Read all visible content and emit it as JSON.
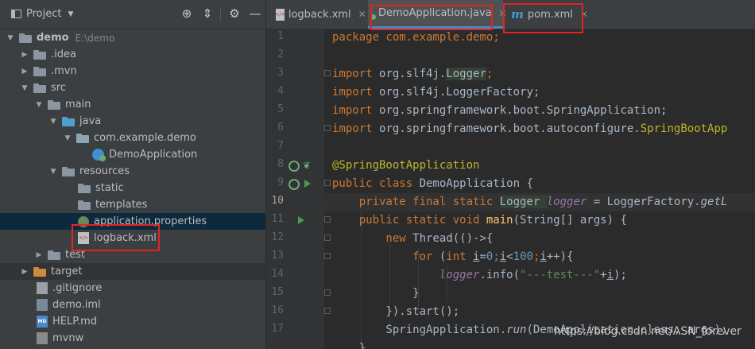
{
  "project_panel": {
    "title": "Project",
    "tree": [
      {
        "label": "demo",
        "path": "E:\\demo",
        "arrow": "▼",
        "folder": "gray"
      },
      {
        "label": ".idea",
        "arrow": "▶",
        "folder": "gray"
      },
      {
        "label": ".mvn",
        "arrow": "▶",
        "folder": "gray"
      },
      {
        "label": "src",
        "arrow": "▼",
        "folder": "gray"
      },
      {
        "label": "main",
        "arrow": "▼",
        "folder": "gray"
      },
      {
        "label": "java",
        "arrow": "▼",
        "folder": "blue"
      },
      {
        "label": "com.example.demo",
        "arrow": "▼",
        "folder": "gray"
      },
      {
        "label": "DemoApplication",
        "file": "spring-class-icon"
      },
      {
        "label": "resources",
        "arrow": "▼",
        "folder": "gray"
      },
      {
        "label": "static",
        "folder": "gray"
      },
      {
        "label": "templates",
        "folder": "gray"
      },
      {
        "label": "application.properties",
        "file": "properties-icon"
      },
      {
        "label": "logback.xml",
        "file": "xml-file-icon"
      },
      {
        "label": "test",
        "arrow": "▶",
        "folder": "gray"
      },
      {
        "label": "target",
        "arrow": "▶",
        "folder": "orange"
      },
      {
        "label": ".gitignore",
        "file": "text-file-icon"
      },
      {
        "label": "demo.iml",
        "file": "iml-file-icon"
      },
      {
        "label": "HELP.md",
        "file": "markdown-file-icon"
      },
      {
        "label": "mvnw",
        "file": "shell-file-icon"
      }
    ]
  },
  "tabs": [
    {
      "label": "logback.xml",
      "icon": "xml-file-icon"
    },
    {
      "label": "DemoApplication.java",
      "icon": "spring-class-icon"
    },
    {
      "label": "pom.xml",
      "icon": "maven-m-icon"
    }
  ],
  "editor": {
    "current_line": 10,
    "line_numbers": [
      "1",
      "2",
      "3",
      "4",
      "5",
      "6",
      "7",
      "8",
      "9",
      "10",
      "11",
      "12",
      "13",
      "14",
      "15",
      "16",
      "17"
    ],
    "lines": [
      [
        "package com.example.demo;"
      ],
      [
        ""
      ],
      [
        "import ",
        "org.slf4j.",
        "Logger",
        ";"
      ],
      [
        "import ",
        "org.slf4j.LoggerFactory;"
      ],
      [
        "import ",
        "org.springframework.boot.SpringApplication;"
      ],
      [
        "import ",
        "org.springframework.boot.autoconfigure.",
        "SpringBootApp"
      ],
      [
        ""
      ],
      [
        "@SpringBootApplication"
      ],
      [
        "public class ",
        "DemoApplication {"
      ],
      [
        "    private final static ",
        "Logger ",
        "logger",
        " = LoggerFactory.",
        "getL"
      ],
      [
        "    public static void ",
        "main",
        "(String[] args) {"
      ],
      [
        "        new ",
        "Thread(()->{"
      ],
      [
        "            for ",
        "(",
        "int ",
        "i",
        "=",
        "0",
        ";",
        "i",
        "<",
        "100",
        ";",
        "i",
        "++){"
      ],
      [
        "                ",
        "logger",
        ".info(",
        "\"---test---\"",
        "+",
        "i",
        ");"
      ],
      [
        "            }"
      ],
      [
        "        }).start();"
      ],
      [
        "        SpringApplication.",
        "run",
        "(DemoApplication.class, args);"
      ]
    ]
  },
  "watermark": "https://blog.csdn.net/ASN_forever"
}
